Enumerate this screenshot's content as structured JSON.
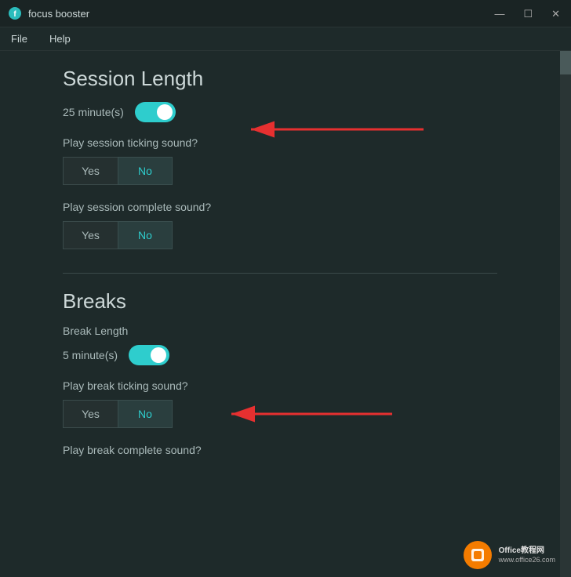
{
  "titlebar": {
    "title": "focus booster",
    "minimize_label": "—",
    "maximize_label": "☐",
    "close_label": "✕"
  },
  "menubar": {
    "items": [
      {
        "label": "File"
      },
      {
        "label": "Help"
      }
    ]
  },
  "session_section": {
    "title": "Session Length",
    "length_value": "25 minute(s)",
    "toggle_state": "on",
    "ticking_sound": {
      "label": "Play session ticking sound?",
      "yes": "Yes",
      "no": "No",
      "selected": "no"
    },
    "complete_sound": {
      "label": "Play session complete sound?",
      "yes": "Yes",
      "no": "No",
      "selected": "no"
    }
  },
  "breaks_section": {
    "title": "Breaks",
    "break_length": {
      "label": "Break Length",
      "value": "5 minute(s)",
      "toggle_state": "on"
    },
    "ticking_sound": {
      "label": "Play break ticking sound?",
      "yes": "Yes",
      "no": "No",
      "selected": "no"
    },
    "complete_sound": {
      "label": "Play break complete sound?"
    }
  },
  "colors": {
    "toggle_on": "#2ecdcd",
    "accent": "#2ecdcd",
    "bg": "#1e2a2a",
    "text": "#aababa"
  }
}
